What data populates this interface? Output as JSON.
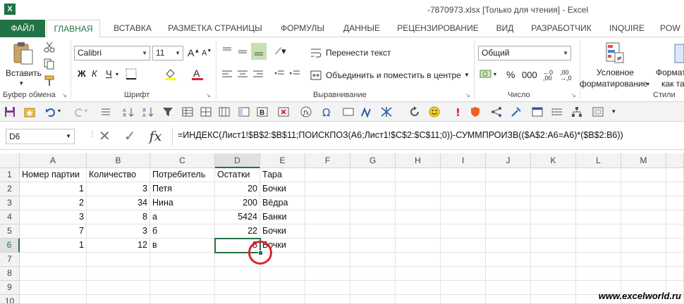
{
  "window": {
    "title": "-7870973.xlsx  [Только для чтения] - Excel",
    "app_icon": "X"
  },
  "tabs": [
    "ФАЙЛ",
    "ГЛАВНАЯ",
    "ВСТАВКА",
    "РАЗМЕТКА СТРАНИЦЫ",
    "ФОРМУЛЫ",
    "ДАННЫЕ",
    "РЕЦЕНЗИРОВАНИЕ",
    "ВИД",
    "РАЗРАБОТЧИК",
    "INQUIRE",
    "POW"
  ],
  "ribbon": {
    "paste_label": "Вставить",
    "clipboard_label": "Буфер обмена",
    "font_name": "Calibri",
    "font_size": "11",
    "font_label": "Шрифт",
    "bold": "Ж",
    "italic": "К",
    "underline": "Ч",
    "wrap_text": "Перенести текст",
    "merge_center": "Объединить и поместить в центре",
    "alignment_label": "Выравнивание",
    "number_format": "Общий",
    "number_label": "Число",
    "cond_format_1": "Условное",
    "cond_format_2": "форматирование",
    "format_table_1": "Форматир",
    "format_table_2": "как таб",
    "styles_label": "Стили"
  },
  "formula_bar": {
    "name_box": "D6",
    "formula": "=ИНДЕКС(Лист1!$B$2:$B$11;ПОИСКПОЗ(A6;Лист1!$C$2:$C$11;0))-СУММПРОИЗВ(($A$2:A6=A6)*($B$2:B6))"
  },
  "sheet": {
    "columns": [
      "A",
      "B",
      "C",
      "D",
      "E",
      "F",
      "G",
      "H",
      "I",
      "J",
      "K",
      "L",
      "M"
    ],
    "rows": [
      "1",
      "2",
      "3",
      "4",
      "5",
      "6",
      "7",
      "8",
      "9",
      "10"
    ],
    "cells": [
      [
        "Номер партии",
        "Количество",
        "Потребитель",
        "Остатки",
        "Тара"
      ],
      [
        "1",
        "3",
        "Петя",
        "20",
        "Бочки"
      ],
      [
        "2",
        "34",
        "Нина",
        "200",
        "Вёдра"
      ],
      [
        "3",
        "8",
        "а",
        "5424",
        "Банки"
      ],
      [
        "7",
        "3",
        "б",
        "22",
        "Бочки"
      ],
      [
        "1",
        "12",
        "в",
        "8",
        "Бочки"
      ]
    ],
    "selected_cell": "D6"
  },
  "watermark": "www.excelworld.ru",
  "colors": {
    "excel_green": "#217346",
    "highlight_circle": "#e0202a"
  }
}
